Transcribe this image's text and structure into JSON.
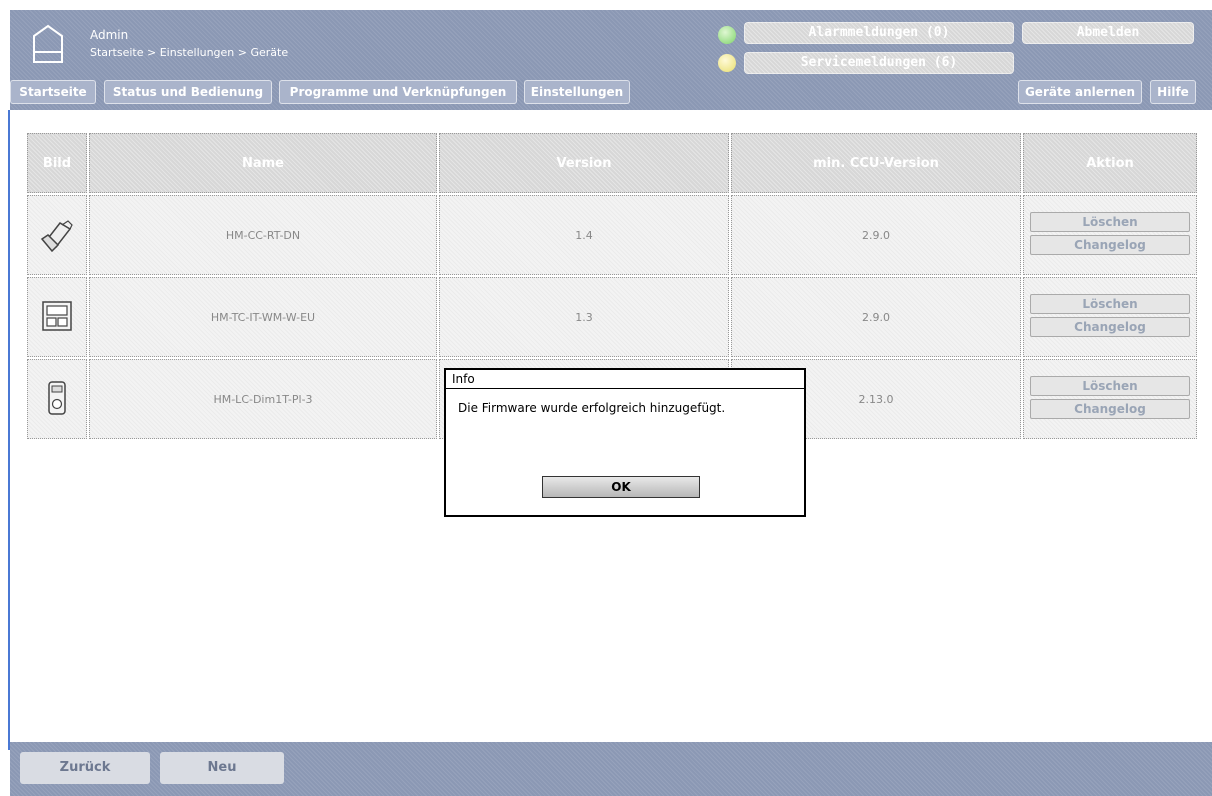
{
  "header": {
    "user": "Admin",
    "breadcrumb": "Startseite > Einstellungen > Geräte",
    "alarm_label": "Alarmmeldungen (0)",
    "service_label": "Servicemeldungen (6)",
    "logout_label": "Abmelden",
    "alarm_status_color": "#7ed36a",
    "service_status_color": "#e8de6e"
  },
  "nav": {
    "startseite": "Startseite",
    "status": "Status und Bedienung",
    "programme": "Programme und Verknüpfungen",
    "einstellungen": "Einstellungen",
    "geraete_anlernen": "Geräte anlernen",
    "hilfe": "Hilfe"
  },
  "table": {
    "headers": {
      "bild": "Bild",
      "name": "Name",
      "version": "Version",
      "ccu": "min. CCU-Version",
      "aktion": "Aktion"
    },
    "rows": [
      {
        "name": "HM-CC-RT-DN",
        "version": "1.4",
        "ccu": "2.9.0",
        "icon": "thermostat-valve-icon",
        "delete": "Löschen",
        "changelog": "Changelog"
      },
      {
        "name": "HM-TC-IT-WM-W-EU",
        "version": "1.3",
        "ccu": "2.9.0",
        "icon": "wall-thermostat-icon",
        "delete": "Löschen",
        "changelog": "Changelog"
      },
      {
        "name": "HM-LC-Dim1T-Pl-3",
        "version": "",
        "ccu": "2.13.0",
        "icon": "plug-dimmer-icon",
        "delete": "Löschen",
        "changelog": "Changelog"
      }
    ]
  },
  "dialog": {
    "title": "Info",
    "message": "Die Firmware wurde erfolgreich hinzugefügt.",
    "ok": "OK"
  },
  "footer": {
    "back": "Zurück",
    "new": "Neu"
  }
}
